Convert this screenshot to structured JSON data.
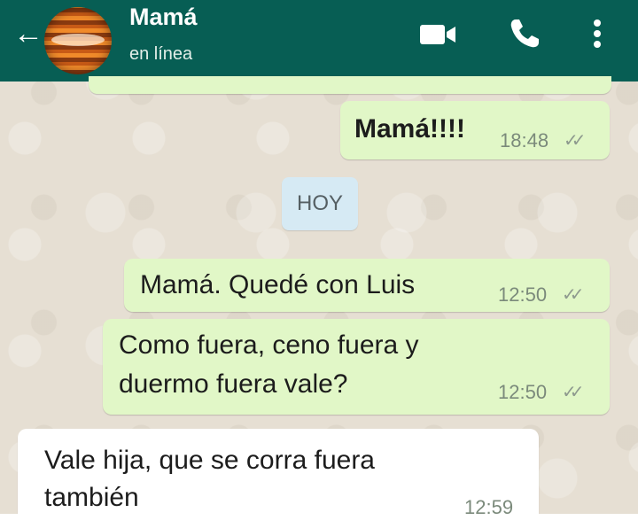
{
  "header": {
    "contact_name": "Mamá",
    "status": "en línea",
    "icons": [
      "back-arrow-icon",
      "video-call-icon",
      "phone-icon",
      "more-options-icon"
    ],
    "color": "#075e54"
  },
  "chat": {
    "date_divider": "HOY",
    "messages": [
      {
        "direction": "outgoing",
        "text": "Mamá!!!!",
        "time": "18:48",
        "status": "read"
      },
      {
        "direction": "outgoing",
        "text": "Mamá. Quedé con Luis",
        "time": "12:50",
        "status": "read"
      },
      {
        "direction": "outgoing",
        "lines": [
          "Como fuera, ceno fuera y",
          "duermo fuera vale?"
        ],
        "time": "12:50",
        "status": "read"
      },
      {
        "direction": "incoming",
        "lines": [
          "Vale hija, que se corra fuera",
          "también"
        ],
        "time": "12:59"
      }
    ],
    "outgoing_color": "#e1f7c7",
    "incoming_color": "#ffffff"
  }
}
